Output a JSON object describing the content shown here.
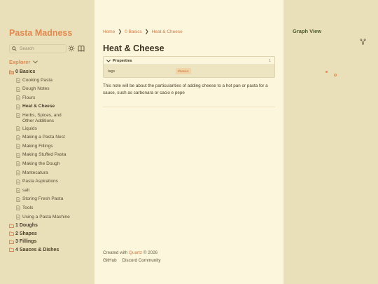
{
  "site": {
    "title": "Pasta Madness"
  },
  "search": {
    "placeholder": "Search"
  },
  "explorer": {
    "label": "Explorer",
    "tree": [
      {
        "type": "folder",
        "label": "0 Basics",
        "open": true
      },
      {
        "type": "file",
        "label": "Cooking Pasta"
      },
      {
        "type": "file",
        "label": "Dough Notes"
      },
      {
        "type": "file",
        "label": "Flours"
      },
      {
        "type": "file",
        "label": "Heat & Cheese",
        "active": true
      },
      {
        "type": "file",
        "label": "Herbs, Spices, and Other Additions"
      },
      {
        "type": "file",
        "label": "Liquids"
      },
      {
        "type": "file",
        "label": "Making a Pasta Nest"
      },
      {
        "type": "file",
        "label": "Making Fillings"
      },
      {
        "type": "file",
        "label": "Making Stuffed Pasta"
      },
      {
        "type": "file",
        "label": "Making the Dough"
      },
      {
        "type": "file",
        "label": "Mantecatura"
      },
      {
        "type": "file",
        "label": "Pasta Aspirations"
      },
      {
        "type": "file",
        "label": "salt"
      },
      {
        "type": "file",
        "label": "Storing Fresh Pasta"
      },
      {
        "type": "file",
        "label": "Tools"
      },
      {
        "type": "file",
        "label": "Using a Pasta Machine"
      },
      {
        "type": "folder",
        "label": "1 Doughs",
        "open": false
      },
      {
        "type": "folder",
        "label": "2 Shapes",
        "open": false
      },
      {
        "type": "folder",
        "label": "3 Fillings",
        "open": false
      },
      {
        "type": "folder",
        "label": "4 Sauces & Dishes",
        "open": false
      }
    ]
  },
  "breadcrumbs": {
    "home": "Home",
    "folder": "0 Basics",
    "current": "Heat & Cheese"
  },
  "page": {
    "title": "Heat & Cheese",
    "properties": {
      "label": "Properties",
      "count": "1",
      "key": "tags",
      "tag": "#basics"
    },
    "body": "This note will be about the particularities of adding cheese to a hot pan or pasta for a sauce, such as carbonara or cacio e pepe"
  },
  "footer": {
    "created_with": "Created with",
    "quartz": "Quartz",
    "copyright": "© 2026",
    "links": {
      "github": "GitHub",
      "discord": "Discord Community"
    }
  },
  "graph": {
    "title": "Graph View"
  },
  "colors": {
    "accent": "#e3894f",
    "sidebar_bg": "#e9dfb9",
    "content_bg": "#fcf6dc",
    "graph_title": "#4f5b2e"
  }
}
